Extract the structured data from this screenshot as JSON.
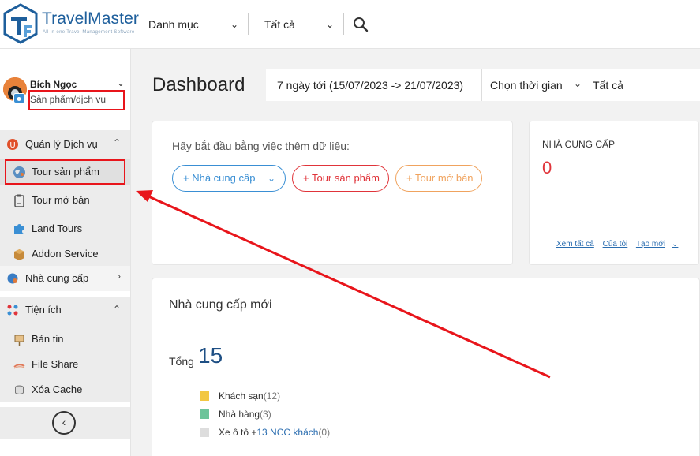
{
  "app": {
    "brand": "TravelMaster",
    "tagline": "All-in-one Travel Management Software"
  },
  "topbar": {
    "category_select": "Danh mục",
    "scope_select": "Tất cả"
  },
  "user": {
    "name": "Bích Ngọc",
    "role": "Sản phẩm/dịch vụ"
  },
  "sidebar": {
    "service_group": {
      "label": "Quản lý Dịch vụ",
      "items": [
        {
          "label": "Tour sản phẩm",
          "icon": "globe-icon"
        },
        {
          "label": "Tour mở bán",
          "icon": "clipboard-icon"
        },
        {
          "label": "Land Tours",
          "icon": "puzzle-icon"
        },
        {
          "label": "Addon Service",
          "icon": "box-icon"
        }
      ]
    },
    "supplier_group": {
      "label": "Nhà cung cấp"
    },
    "utility_group": {
      "label": "Tiện ích",
      "items": [
        {
          "label": "Bản tin",
          "icon": "news-icon"
        },
        {
          "label": "File Share",
          "icon": "share-icon"
        },
        {
          "label": "Xóa Cache",
          "icon": "cache-icon"
        }
      ]
    }
  },
  "dashboard": {
    "title": "Dashboard",
    "range": "7 ngày tới (15/07/2023 -> 21/07/2023)",
    "period_select": "Chọn thời gian",
    "scope": "Tất cả"
  },
  "start_card": {
    "text": "Hãy bắt đầu bằng việc thêm dữ liệu:",
    "add_supplier": "+ Nhà cung cấp",
    "add_tour": "+ Tour sản phẩm",
    "add_open_tour": "+ Tour mở bán"
  },
  "supplier_card": {
    "title": "NHÀ CUNG CẤP",
    "count": "0",
    "view_all": "Xem tất cả",
    "mine": "Của tôi",
    "create": "Tạo mới"
  },
  "new_suppliers": {
    "title": "Nhà cung cấp mới",
    "total_label": "Tổng",
    "total": "15",
    "legend": [
      {
        "label": "Khách sạn",
        "count": "(12)",
        "color": "#f2c744"
      },
      {
        "label": "Nhà hàng",
        "count": "(3)",
        "color": "#6cc49a"
      },
      {
        "label": "Xe ô tô +",
        "link": "13 NCC khách",
        "count": "(0)",
        "color": "#dddddd"
      }
    ]
  },
  "colors": {
    "brand_blue": "#1e5f9c",
    "accent_red": "#e0343a",
    "highlight_red": "#e8151b"
  }
}
